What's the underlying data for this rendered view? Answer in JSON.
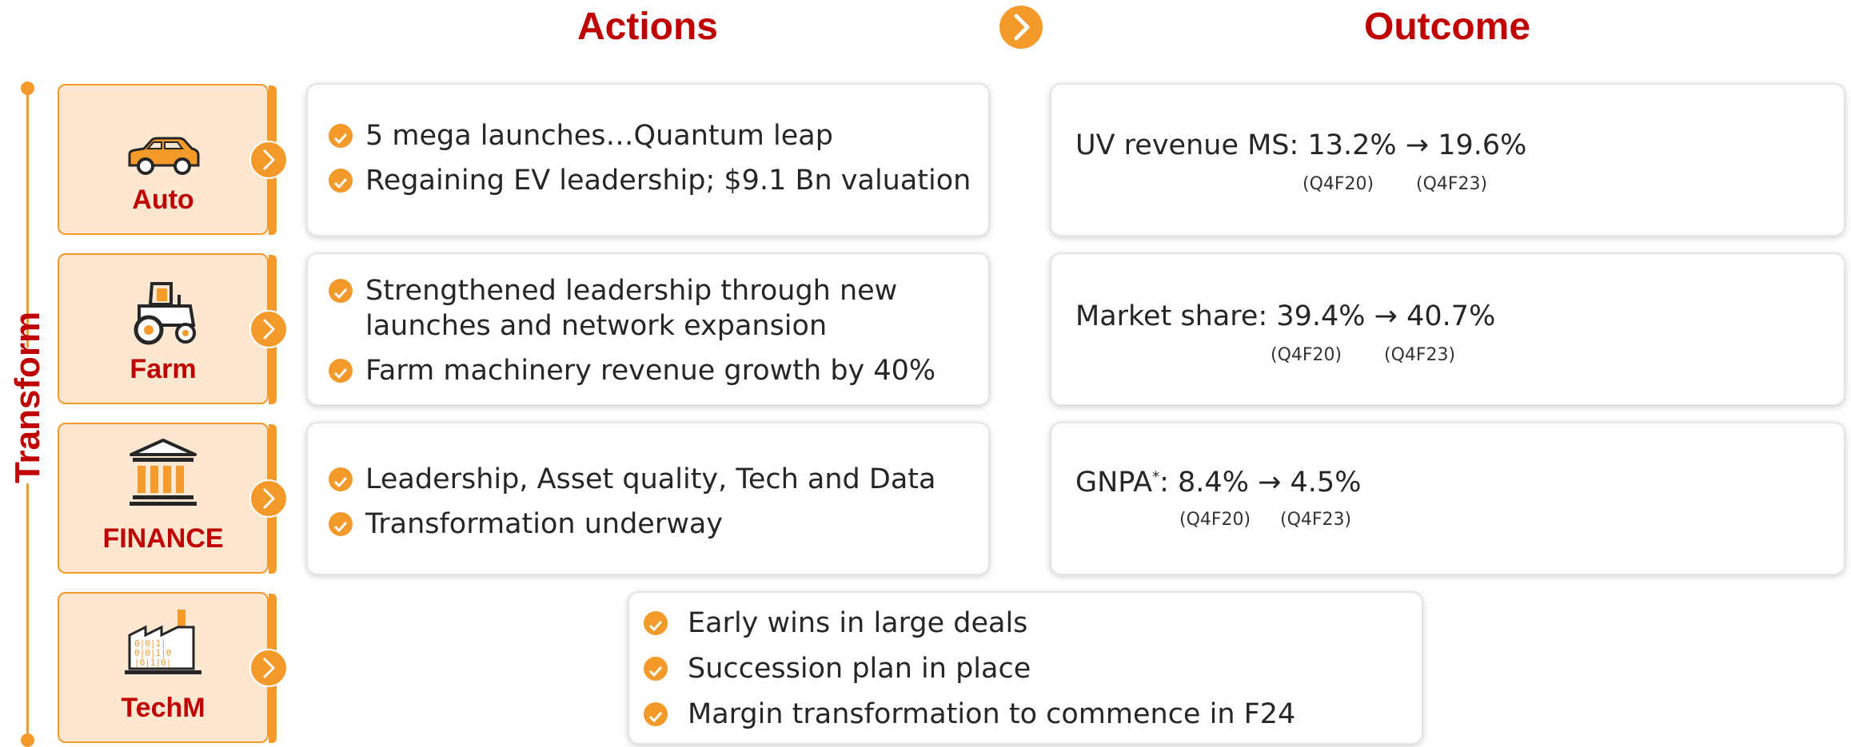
{
  "headers": {
    "actions": "Actions",
    "outcome": "Outcome"
  },
  "side_label": "Transform",
  "colors": {
    "accent": "#f39a2b",
    "title_red": "#c00000",
    "tile_fill": "#fde7d1"
  },
  "segments": [
    {
      "label": "Auto",
      "icon": "car-icon",
      "actions": [
        "5 mega launches…Quantum leap",
        "Regaining EV leadership; $9.1 Bn valuation"
      ],
      "outcome": {
        "text": "UV revenue MS: 13.2% → 19.6%",
        "from_period": "(Q4F20)",
        "to_period": "(Q4F23)"
      }
    },
    {
      "label": "Farm",
      "icon": "tractor-icon",
      "actions": [
        "Strengthened leadership through new launches and network expansion",
        "Farm machinery revenue growth by 40%"
      ],
      "outcome": {
        "text": "Market share: 39.4% → 40.7%",
        "from_period": "(Q4F20)",
        "to_period": "(Q4F23)"
      }
    },
    {
      "label": "FINANCE",
      "icon": "bank-icon",
      "actions": [
        "Leadership, Asset quality, Tech and Data",
        "Transformation underway"
      ],
      "outcome": {
        "prefix": "GNPA",
        "sup": "*",
        "text": ": 8.4% → 4.5%",
        "from_period": "(Q4F20)",
        "to_period": "(Q4F23)"
      }
    },
    {
      "label": "TechM",
      "icon": "factory-data-icon",
      "actions": [
        "Early wins in large deals",
        "Succession plan in place",
        "Margin transformation to commence in F24"
      ]
    }
  ]
}
